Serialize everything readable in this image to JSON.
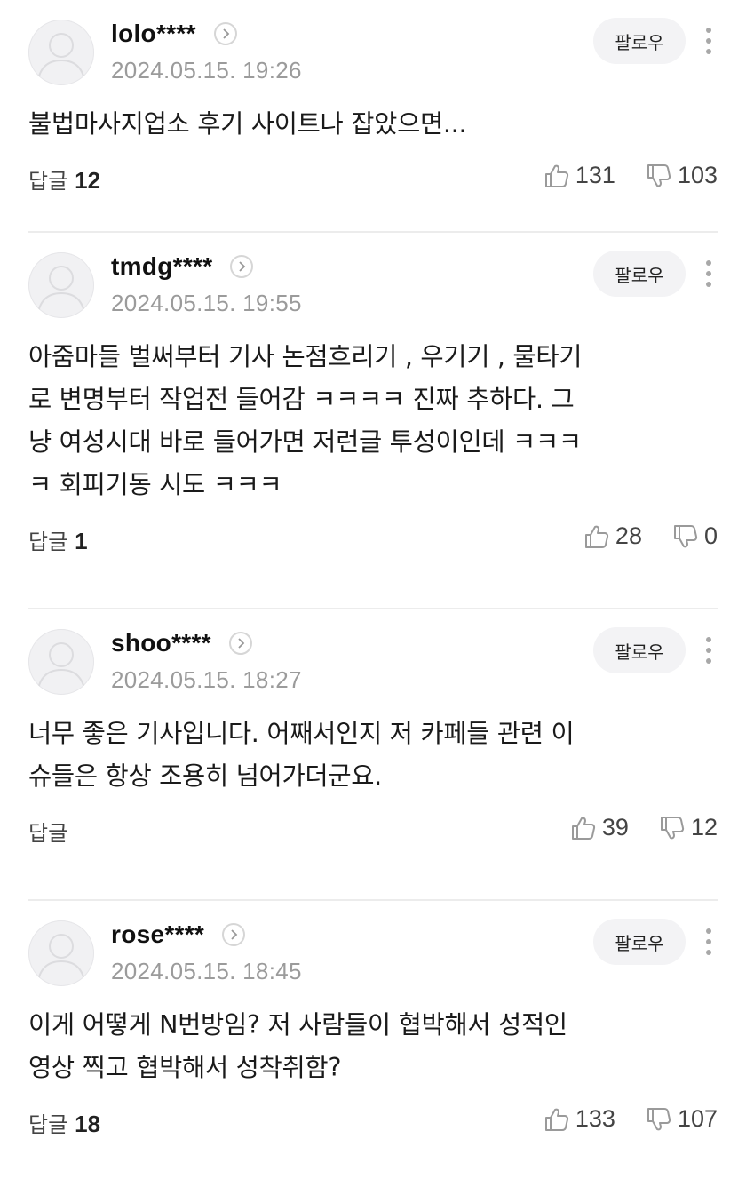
{
  "follow_label": "팔로우",
  "reply_label": "답글",
  "comments": [
    {
      "username": "lolo****",
      "date": "2024.05.15. 19:26",
      "text": "불법마사지업소 후기 사이트나 잡았으면...",
      "reply_count": "12",
      "likes": "131",
      "dislikes": "103"
    },
    {
      "username": "tmdg****",
      "date": "2024.05.15. 19:55",
      "text": "아줌마들 벌써부터 기사 논점흐리기 , 우기기 , 물타기\n로 변명부터 작업전 들어감 ㅋㅋㅋㅋ 진짜 추하다. 그\n냥 여성시대 바로 들어가면 저런글 투성이인데 ㅋㅋㅋ\nㅋ 회피기동 시도 ㅋㅋㅋ",
      "reply_count": "1",
      "likes": "28",
      "dislikes": "0"
    },
    {
      "username": "shoo****",
      "date": "2024.05.15. 18:27",
      "text": "너무 좋은 기사입니다. 어째서인지 저 카페들 관련 이\n슈들은 항상 조용히 넘어가더군요.",
      "reply_count": "",
      "likes": "39",
      "dislikes": "12"
    },
    {
      "username": "rose****",
      "date": "2024.05.15. 18:45",
      "text": "이게 어떻게 N번방임? 저 사람들이 협박해서 성적인\n영상 찍고 협박해서 성착취함?",
      "reply_count": "18",
      "likes": "133",
      "dislikes": "107"
    }
  ],
  "icons": {
    "avatar": "default-user-avatar-icon",
    "profile": "chevron-right-icon",
    "more": "more-vertical-icon",
    "like": "thumbs-up-icon",
    "dislike": "thumbs-down-icon"
  },
  "colors": {
    "date": "#9b9b9b",
    "divider": "#ececec",
    "follow_bg": "#f3f3f5",
    "icon": "#9a9a9a"
  }
}
